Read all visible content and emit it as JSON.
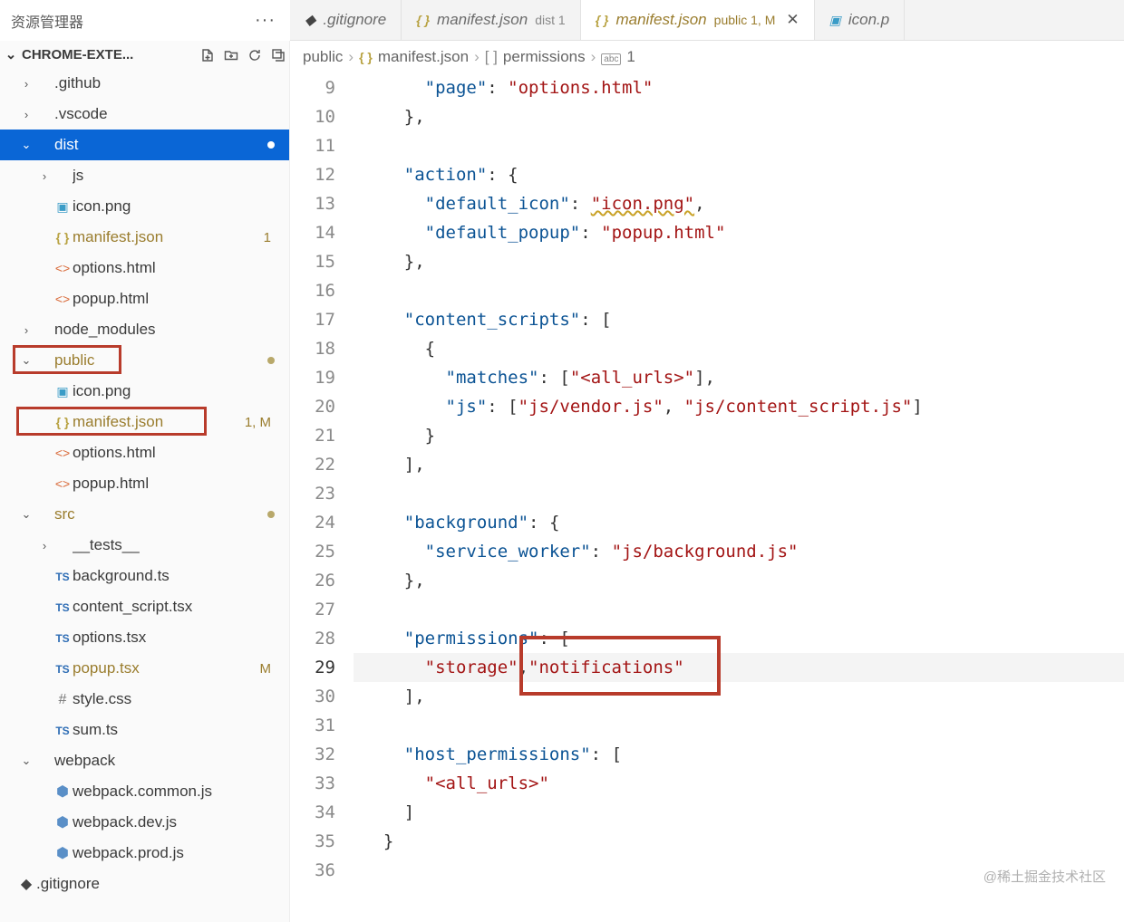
{
  "explorer": {
    "title": "资源管理器"
  },
  "project": {
    "name": "CHROME-EXTE..."
  },
  "tabs": [
    {
      "icon": "git",
      "label": ".gitignore",
      "suffix": "",
      "active": false,
      "close": false
    },
    {
      "icon": "json",
      "label": "manifest.json",
      "suffix": "dist 1",
      "active": false,
      "close": false
    },
    {
      "icon": "json",
      "label": "manifest.json",
      "suffix": "public 1, M",
      "active": true,
      "close": true
    },
    {
      "icon": "img",
      "label": "icon.p",
      "suffix": "",
      "active": false,
      "close": false
    }
  ],
  "breadcrumb": {
    "parts": [
      "public",
      "manifest.json",
      "permissions",
      "1"
    ],
    "icons": [
      "",
      "json",
      "brackets",
      "abc"
    ]
  },
  "tree": [
    {
      "depth": 0,
      "type": "folder",
      "chev": "right",
      "label": ".github"
    },
    {
      "depth": 0,
      "type": "folder",
      "chev": "right",
      "label": ".vscode"
    },
    {
      "depth": 0,
      "type": "folder",
      "chev": "down",
      "label": "dist",
      "selected": true,
      "dot": true
    },
    {
      "depth": 1,
      "type": "folder",
      "chev": "right",
      "label": "js"
    },
    {
      "depth": 1,
      "type": "file",
      "icon": "img",
      "label": "icon.png"
    },
    {
      "depth": 1,
      "type": "file",
      "icon": "json",
      "label": "manifest.json",
      "modified": true,
      "badge": "1"
    },
    {
      "depth": 1,
      "type": "file",
      "icon": "html",
      "label": "options.html"
    },
    {
      "depth": 1,
      "type": "file",
      "icon": "html",
      "label": "popup.html"
    },
    {
      "depth": 0,
      "type": "folder",
      "chev": "right",
      "label": "node_modules"
    },
    {
      "depth": 0,
      "type": "folder",
      "chev": "down",
      "label": "public",
      "modified": true,
      "dot": true,
      "hl": "public"
    },
    {
      "depth": 1,
      "type": "file",
      "icon": "img",
      "label": "icon.png"
    },
    {
      "depth": 1,
      "type": "file",
      "icon": "json",
      "label": "manifest.json",
      "modified": true,
      "badge": "1, M",
      "hl": "manifest"
    },
    {
      "depth": 1,
      "type": "file",
      "icon": "html",
      "label": "options.html"
    },
    {
      "depth": 1,
      "type": "file",
      "icon": "html",
      "label": "popup.html"
    },
    {
      "depth": 0,
      "type": "folder",
      "chev": "down",
      "label": "src",
      "modified": true,
      "dot": true
    },
    {
      "depth": 1,
      "type": "folder",
      "chev": "right",
      "label": "__tests__"
    },
    {
      "depth": 1,
      "type": "file",
      "icon": "ts",
      "label": "background.ts"
    },
    {
      "depth": 1,
      "type": "file",
      "icon": "ts",
      "label": "content_script.tsx"
    },
    {
      "depth": 1,
      "type": "file",
      "icon": "ts",
      "label": "options.tsx"
    },
    {
      "depth": 1,
      "type": "file",
      "icon": "ts",
      "label": "popup.tsx",
      "modified": true,
      "badge": "M"
    },
    {
      "depth": 1,
      "type": "file",
      "icon": "hash",
      "label": "style.css"
    },
    {
      "depth": 1,
      "type": "file",
      "icon": "ts",
      "label": "sum.ts"
    },
    {
      "depth": 0,
      "type": "folder",
      "chev": "down",
      "label": "webpack"
    },
    {
      "depth": 1,
      "type": "file",
      "icon": "cube",
      "label": "webpack.common.js"
    },
    {
      "depth": 1,
      "type": "file",
      "icon": "cube",
      "label": "webpack.dev.js"
    },
    {
      "depth": 1,
      "type": "file",
      "icon": "cube",
      "label": "webpack.prod.js"
    },
    {
      "depth": 0,
      "type": "file",
      "icon": "git",
      "label": ".gitignore",
      "indent_override": -1
    }
  ],
  "code": {
    "first_line": 9,
    "current_line": 29,
    "lines": [
      [
        [
          "      ",
          ""
        ],
        [
          "\"page\"",
          "key"
        ],
        [
          ": ",
          "punc"
        ],
        [
          "\"options.html\"",
          "str"
        ]
      ],
      [
        [
          "    ",
          ""
        ],
        [
          "}",
          "brace"
        ],
        [
          ",",
          "punc"
        ]
      ],
      [
        [
          "",
          ""
        ]
      ],
      [
        [
          "    ",
          ""
        ],
        [
          "\"action\"",
          "key"
        ],
        [
          ": ",
          "punc"
        ],
        [
          "{",
          "brace"
        ]
      ],
      [
        [
          "      ",
          ""
        ],
        [
          "\"default_icon\"",
          "key"
        ],
        [
          ": ",
          "punc"
        ],
        [
          "\"icon.png\"",
          "str warn"
        ],
        [
          ",",
          "punc"
        ]
      ],
      [
        [
          "      ",
          ""
        ],
        [
          "\"default_popup\"",
          "key"
        ],
        [
          ": ",
          "punc"
        ],
        [
          "\"popup.html\"",
          "str"
        ]
      ],
      [
        [
          "    ",
          ""
        ],
        [
          "}",
          "brace"
        ],
        [
          ",",
          "punc"
        ]
      ],
      [
        [
          "",
          ""
        ]
      ],
      [
        [
          "    ",
          ""
        ],
        [
          "\"content_scripts\"",
          "key"
        ],
        [
          ": ",
          "punc"
        ],
        [
          "[",
          "brace"
        ]
      ],
      [
        [
          "      ",
          ""
        ],
        [
          "{",
          "brace"
        ]
      ],
      [
        [
          "        ",
          ""
        ],
        [
          "\"matches\"",
          "key"
        ],
        [
          ": ",
          "punc"
        ],
        [
          "[",
          "brace"
        ],
        [
          "\"<all_urls>\"",
          "str"
        ],
        [
          "]",
          "brace"
        ],
        [
          ",",
          "punc"
        ]
      ],
      [
        [
          "        ",
          ""
        ],
        [
          "\"js\"",
          "key"
        ],
        [
          ": ",
          "punc"
        ],
        [
          "[",
          "brace"
        ],
        [
          "\"js/vendor.js\"",
          "str"
        ],
        [
          ", ",
          "punc"
        ],
        [
          "\"js/content_script.js\"",
          "str"
        ],
        [
          "]",
          "brace"
        ]
      ],
      [
        [
          "      ",
          ""
        ],
        [
          "}",
          "brace"
        ]
      ],
      [
        [
          "    ",
          ""
        ],
        [
          "]",
          "brace"
        ],
        [
          ",",
          "punc"
        ]
      ],
      [
        [
          "",
          ""
        ]
      ],
      [
        [
          "    ",
          ""
        ],
        [
          "\"background\"",
          "key"
        ],
        [
          ": ",
          "punc"
        ],
        [
          "{",
          "brace"
        ]
      ],
      [
        [
          "      ",
          ""
        ],
        [
          "\"service_worker\"",
          "key"
        ],
        [
          ": ",
          "punc"
        ],
        [
          "\"js/background.js\"",
          "str"
        ]
      ],
      [
        [
          "    ",
          ""
        ],
        [
          "}",
          "brace"
        ],
        [
          ",",
          "punc"
        ]
      ],
      [
        [
          "",
          ""
        ]
      ],
      [
        [
          "    ",
          ""
        ],
        [
          "\"permissions\"",
          "key"
        ],
        [
          ": ",
          "punc"
        ],
        [
          "[",
          "brace"
        ]
      ],
      [
        [
          "      ",
          ""
        ],
        [
          "\"storage\"",
          "str"
        ],
        [
          ",",
          "punc"
        ],
        [
          "\"notifications\"",
          "str hl-notif"
        ]
      ],
      [
        [
          "    ",
          ""
        ],
        [
          "]",
          "brace"
        ],
        [
          ",",
          "punc"
        ]
      ],
      [
        [
          "",
          ""
        ]
      ],
      [
        [
          "    ",
          ""
        ],
        [
          "\"host_permissions\"",
          "key"
        ],
        [
          ": ",
          "punc"
        ],
        [
          "[",
          "brace"
        ]
      ],
      [
        [
          "      ",
          ""
        ],
        [
          "\"<all_urls>\"",
          "str"
        ]
      ],
      [
        [
          "    ",
          ""
        ],
        [
          "]",
          "brace"
        ]
      ],
      [
        [
          "  ",
          ""
        ],
        [
          "}",
          "brace"
        ]
      ],
      [
        [
          "",
          ""
        ]
      ]
    ]
  },
  "watermark": "@稀土掘金技术社区"
}
